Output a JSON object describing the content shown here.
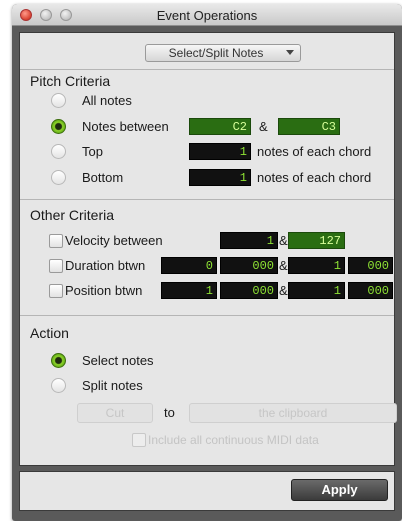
{
  "window": {
    "title": "Event Operations"
  },
  "mode_dropdown": {
    "selected": "Select/Split Notes"
  },
  "pitch_criteria": {
    "title": "Pitch Criteria",
    "options": [
      {
        "label": "All notes",
        "selected": false
      },
      {
        "label": "Notes between",
        "selected": true,
        "low": "C2",
        "and": "&",
        "high": "C3"
      },
      {
        "label": "Top",
        "selected": false,
        "value": "1",
        "suffix": "notes of each chord"
      },
      {
        "label": "Bottom",
        "selected": false,
        "value": "1",
        "suffix": "notes of each chord"
      }
    ]
  },
  "other_criteria": {
    "title": "Other Criteria",
    "velocity": {
      "label": "Velocity between",
      "checked": false,
      "low": "1",
      "and": "&",
      "high": "127"
    },
    "duration": {
      "label": "Duration btwn",
      "checked": false,
      "low_a": "0",
      "low_b": "000",
      "and": "&",
      "high_a": "1",
      "high_b": "000"
    },
    "position": {
      "label": "Position btwn",
      "checked": false,
      "low_a": "1",
      "low_b": "000",
      "and": "&",
      "high_a": "1",
      "high_b": "000"
    }
  },
  "action": {
    "title": "Action",
    "select_notes": {
      "label": "Select notes",
      "selected": true
    },
    "split_notes": {
      "label": "Split notes",
      "selected": false
    },
    "cut_label": "Cut",
    "to_label": "to",
    "destination_label": "the clipboard",
    "include_midi_label": "Include all continuous MIDI data"
  },
  "footer": {
    "apply_label": "Apply"
  },
  "colors": {
    "field_bg": "#111111",
    "field_text": "#8ee234",
    "radio_on": "#6cc01c"
  }
}
